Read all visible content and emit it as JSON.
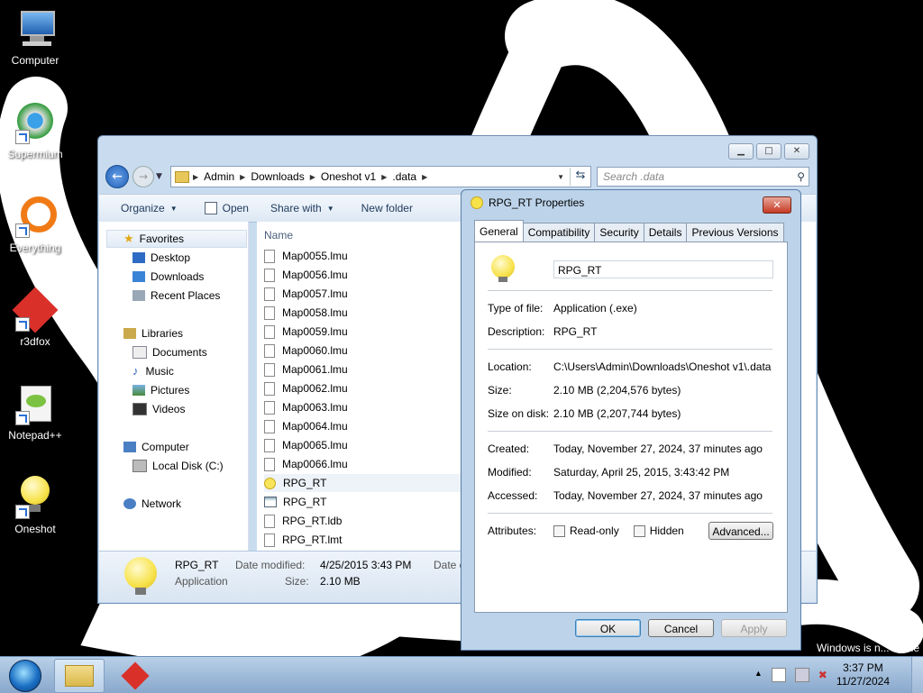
{
  "desktop": {
    "icons": [
      {
        "label": "Computer"
      },
      {
        "label": "Supermium"
      },
      {
        "label": "Everything"
      },
      {
        "label": "r3dfox"
      },
      {
        "label": "Notepad++"
      },
      {
        "label": "Oneshot"
      }
    ],
    "activation_text": "Windows is n... name"
  },
  "explorer": {
    "breadcrumb": [
      "Admin",
      "Downloads",
      "Oneshot v1",
      ".data"
    ],
    "search_placeholder": "Search .data",
    "toolbar": {
      "organize": "Organize",
      "open": "Open",
      "share_with": "Share with",
      "new_folder": "New folder"
    },
    "nav": {
      "favorites": "Favorites",
      "desktop": "Desktop",
      "downloads": "Downloads",
      "recent_places": "Recent Places",
      "libraries": "Libraries",
      "documents": "Documents",
      "music": "Music",
      "pictures": "Pictures",
      "videos": "Videos",
      "computer": "Computer",
      "local_disk": "Local Disk (C:)",
      "network": "Network"
    },
    "column_name": "Name",
    "files": [
      {
        "name": "Map0055.lmu",
        "kind": "doc"
      },
      {
        "name": "Map0056.lmu",
        "kind": "doc"
      },
      {
        "name": "Map0057.lmu",
        "kind": "doc"
      },
      {
        "name": "Map0058.lmu",
        "kind": "doc"
      },
      {
        "name": "Map0059.lmu",
        "kind": "doc"
      },
      {
        "name": "Map0060.lmu",
        "kind": "doc"
      },
      {
        "name": "Map0061.lmu",
        "kind": "doc"
      },
      {
        "name": "Map0062.lmu",
        "kind": "doc"
      },
      {
        "name": "Map0063.lmu",
        "kind": "doc"
      },
      {
        "name": "Map0064.lmu",
        "kind": "doc"
      },
      {
        "name": "Map0065.lmu",
        "kind": "doc"
      },
      {
        "name": "Map0066.lmu",
        "kind": "doc"
      },
      {
        "name": "RPG_RT",
        "kind": "bulb"
      },
      {
        "name": "RPG_RT",
        "kind": "exe"
      },
      {
        "name": "RPG_RT.ldb",
        "kind": "doc"
      },
      {
        "name": "RPG_RT.lmt",
        "kind": "doc"
      }
    ],
    "details": {
      "name": "RPG_RT",
      "type": "Application",
      "date_modified_label": "Date modified:",
      "date_modified": "4/25/2015 3:43 PM",
      "size_label": "Size:",
      "size": "2.10 MB",
      "date_created_partial": "Date c"
    }
  },
  "properties": {
    "title": "RPG_RT Properties",
    "tabs": [
      "General",
      "Compatibility",
      "Security",
      "Details",
      "Previous Versions"
    ],
    "active_tab": "General",
    "name_value": "RPG_RT",
    "type_label": "Type of file:",
    "type_value": "Application (.exe)",
    "desc_label": "Description:",
    "desc_value": "RPG_RT",
    "location_label": "Location:",
    "location_value": "C:\\Users\\Admin\\Downloads\\Oneshot v1\\.data",
    "size_label": "Size:",
    "size_value": "2.10 MB (2,204,576 bytes)",
    "size_disk_label": "Size on disk:",
    "size_disk_value": "2.10 MB (2,207,744 bytes)",
    "created_label": "Created:",
    "created_value": "Today, November 27, 2024, 37 minutes ago",
    "modified_label": "Modified:",
    "modified_value": "Saturday, April 25, 2015, 3:43:42 PM",
    "accessed_label": "Accessed:",
    "accessed_value": "Today, November 27, 2024, 37 minutes ago",
    "attributes_label": "Attributes:",
    "readonly_label": "Read-only",
    "hidden_label": "Hidden",
    "advanced_label": "Advanced...",
    "ok": "OK",
    "cancel": "Cancel",
    "apply": "Apply"
  },
  "taskbar": {
    "time": "3:37 PM",
    "date": "11/27/2024"
  }
}
